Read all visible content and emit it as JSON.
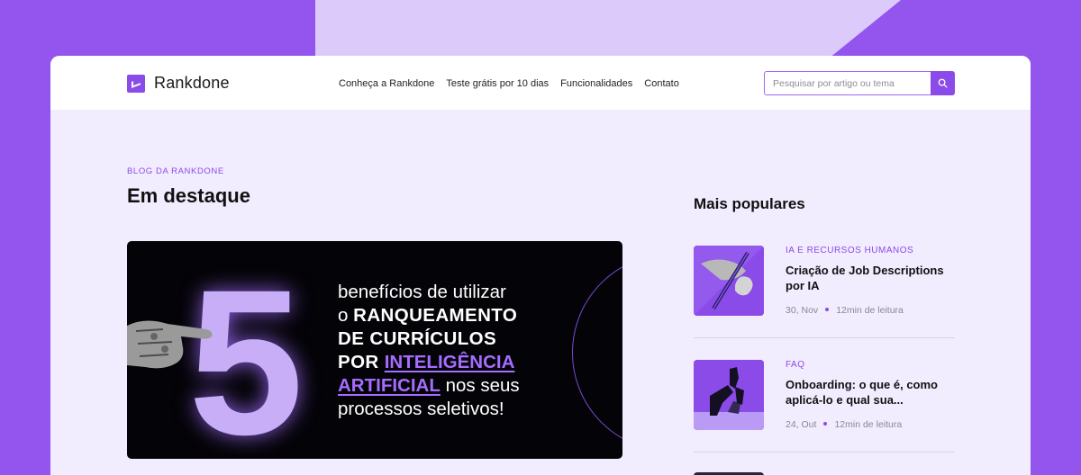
{
  "brand": {
    "name": "Rankdone",
    "accent": "#8b4be8"
  },
  "nav": [
    {
      "label": "Conheça a Rankdone"
    },
    {
      "label": "Teste grátis por 10 dias"
    },
    {
      "label": "Funcionalidades"
    },
    {
      "label": "Contato"
    }
  ],
  "search": {
    "placeholder": "Pesquisar por artigo ou tema",
    "icon": "search-icon"
  },
  "blog": {
    "eyebrow": "BLOG DA RANKDONE",
    "title": "Em destaque"
  },
  "featured": {
    "number": "5",
    "line1": "benefícios de utilizar",
    "line2_pre": "o ",
    "line2_bold": "RANQUEAMENTO",
    "line3": "DE CURRÍCULOS",
    "line4_bold": "POR ",
    "line4_hl": "INTELIGÊNCIA",
    "line5_hl": "ARTIFICIAL",
    "line5_rest": " nos seus",
    "line6": "processos seletivos!"
  },
  "popular": {
    "title": "Mais populares",
    "posts": [
      {
        "category": "IA E RECURSOS HUMANOS",
        "title": "Criação de Job Descriptions por IA",
        "date": "30, Nov",
        "read": "12min de leitura"
      },
      {
        "category": "FAQ",
        "title": "Onboarding: o que é, como aplicá-lo e qual sua...",
        "date": "24, Out",
        "read": "12min de leitura"
      }
    ]
  }
}
